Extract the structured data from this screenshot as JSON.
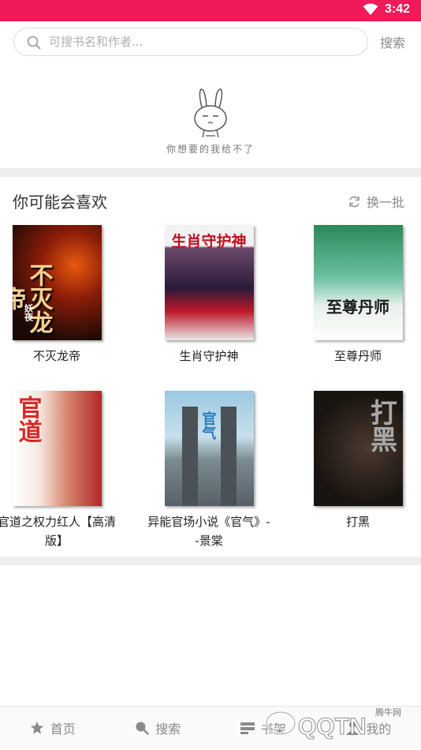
{
  "status_bar": {
    "time": "3:42",
    "background": "#f0195a"
  },
  "search": {
    "placeholder": "可搜书名和作者...",
    "button_label": "搜索"
  },
  "empty_state": {
    "message": "你想要的我给不了"
  },
  "recommend": {
    "title": "你可能会喜欢",
    "refresh_label": "换一批",
    "books": [
      {
        "title": "不灭龙帝",
        "cover_text": "不灭龙帝",
        "cover_author": "妖夜"
      },
      {
        "title": "生肖守护神",
        "cover_text": "生肖守护神",
        "cover_author": ""
      },
      {
        "title": "至尊丹师",
        "cover_text": "至尊丹师",
        "cover_author": ""
      },
      {
        "title": "官道之权力红人【高清版】",
        "cover_text": "官道",
        "cover_author": ""
      },
      {
        "title": "异能官场小说《官气》--景棠",
        "cover_text": "官气",
        "cover_author": ""
      },
      {
        "title": "打黑",
        "cover_text": "打黑",
        "cover_author": ""
      }
    ]
  },
  "bottom_nav": [
    {
      "label": "首页",
      "icon": "star-icon"
    },
    {
      "label": "搜索",
      "icon": "search-icon"
    },
    {
      "label": "书架",
      "icon": "bookshelf-icon"
    },
    {
      "label": "我的",
      "icon": "user-icon"
    }
  ],
  "watermark": {
    "text": "QQTN",
    "subtext": "腾牛网"
  }
}
